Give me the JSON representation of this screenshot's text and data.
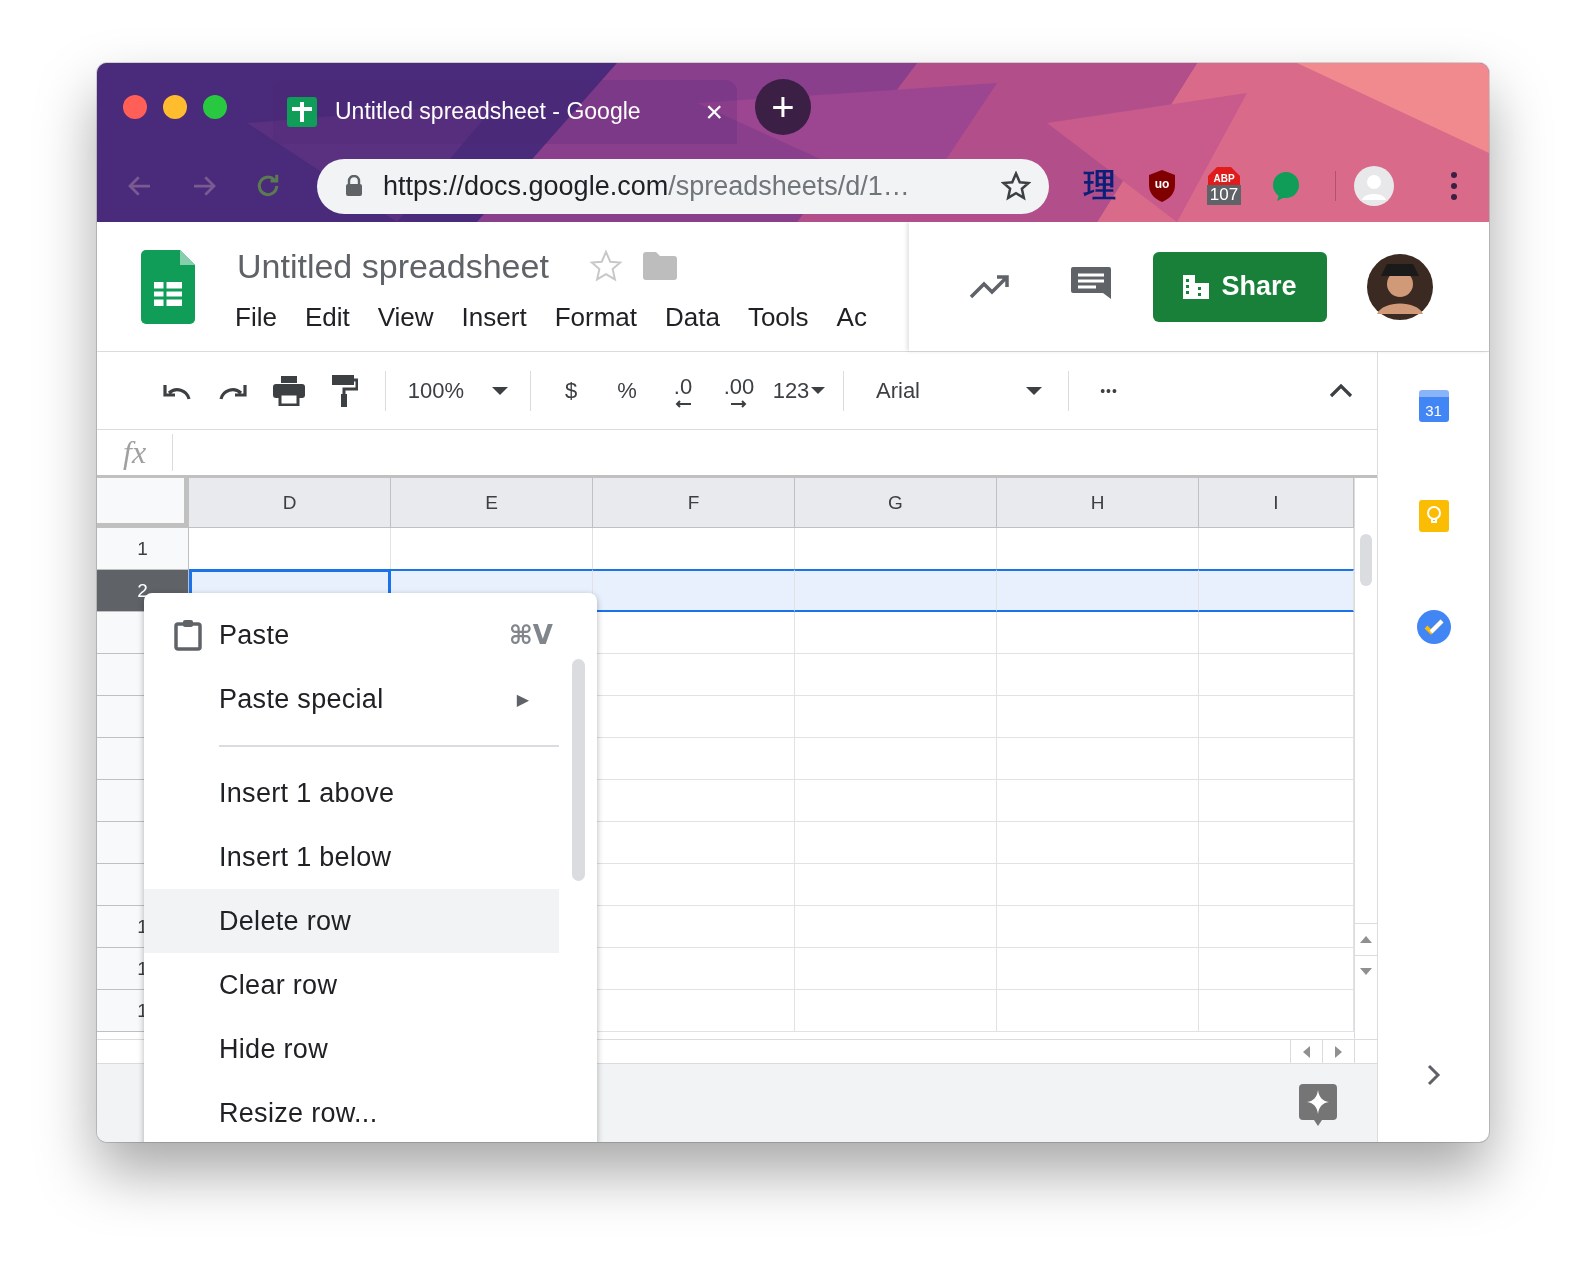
{
  "browser": {
    "tab_title": "Untitled spreadsheet - Google",
    "tab_close": "×",
    "new_tab": "+",
    "url_host": "https://docs.google.com",
    "url_path": "/spreadsheets/d/1…",
    "extensions": [
      {
        "kind": "glyph",
        "text": "理"
      },
      {
        "kind": "shield",
        "text": "uo"
      },
      {
        "kind": "abp",
        "text": "ABP",
        "badge": "107"
      },
      {
        "kind": "bubble"
      }
    ]
  },
  "doc": {
    "title": "Untitled spreadsheet",
    "menus": [
      "File",
      "Edit",
      "View",
      "Insert",
      "Format",
      "Data",
      "Tools",
      "Ac"
    ],
    "share": "Share"
  },
  "toolbar": {
    "zoom": "100%",
    "currency": "$",
    "percent": "%",
    "decrease_decimals": ".0",
    "increase_decimals": ".00",
    "number_format": "123",
    "font": "Arial",
    "more": "•••"
  },
  "formula_bar": {
    "fx": "fx"
  },
  "grid": {
    "columns": [
      {
        "label": "D",
        "selected": false
      },
      {
        "label": "E",
        "selected": false
      },
      {
        "label": "F",
        "selected": false
      },
      {
        "label": "G",
        "selected": false
      },
      {
        "label": "H",
        "selected": false
      },
      {
        "label": "I",
        "selected": false
      }
    ],
    "rows": [
      {
        "label": "1",
        "selected": false
      },
      {
        "label": "2",
        "selected": true
      },
      {
        "selected": false
      },
      {
        "selected": false
      },
      {
        "selected": false
      },
      {
        "selected": false
      },
      {
        "selected": false
      },
      {
        "selected": false
      },
      {
        "selected": false
      },
      {
        "label": "1",
        "selected": false
      },
      {
        "label": "1",
        "selected": false
      },
      {
        "label": "1",
        "selected": false
      }
    ]
  },
  "context_menu": {
    "items": [
      {
        "kind": "clipboard_item",
        "label": "Paste",
        "shortcut": "⌘V",
        "highlighted": false
      },
      {
        "kind": "submenu",
        "label": "Paste special",
        "arrow": "▶",
        "highlighted": false
      },
      {
        "kind": "divider"
      },
      {
        "kind": "item",
        "label": "Insert 1 above",
        "highlighted": false
      },
      {
        "kind": "item",
        "label": "Insert 1 below",
        "highlighted": false
      },
      {
        "kind": "item",
        "label": "Delete row",
        "highlighted": true
      },
      {
        "kind": "item",
        "label": "Clear row",
        "highlighted": false
      },
      {
        "kind": "item",
        "label": "Hide row",
        "highlighted": false
      },
      {
        "kind": "item",
        "label": "Resize row...",
        "highlighted": false
      }
    ]
  },
  "side_panel": {
    "calendar_day": "31"
  }
}
